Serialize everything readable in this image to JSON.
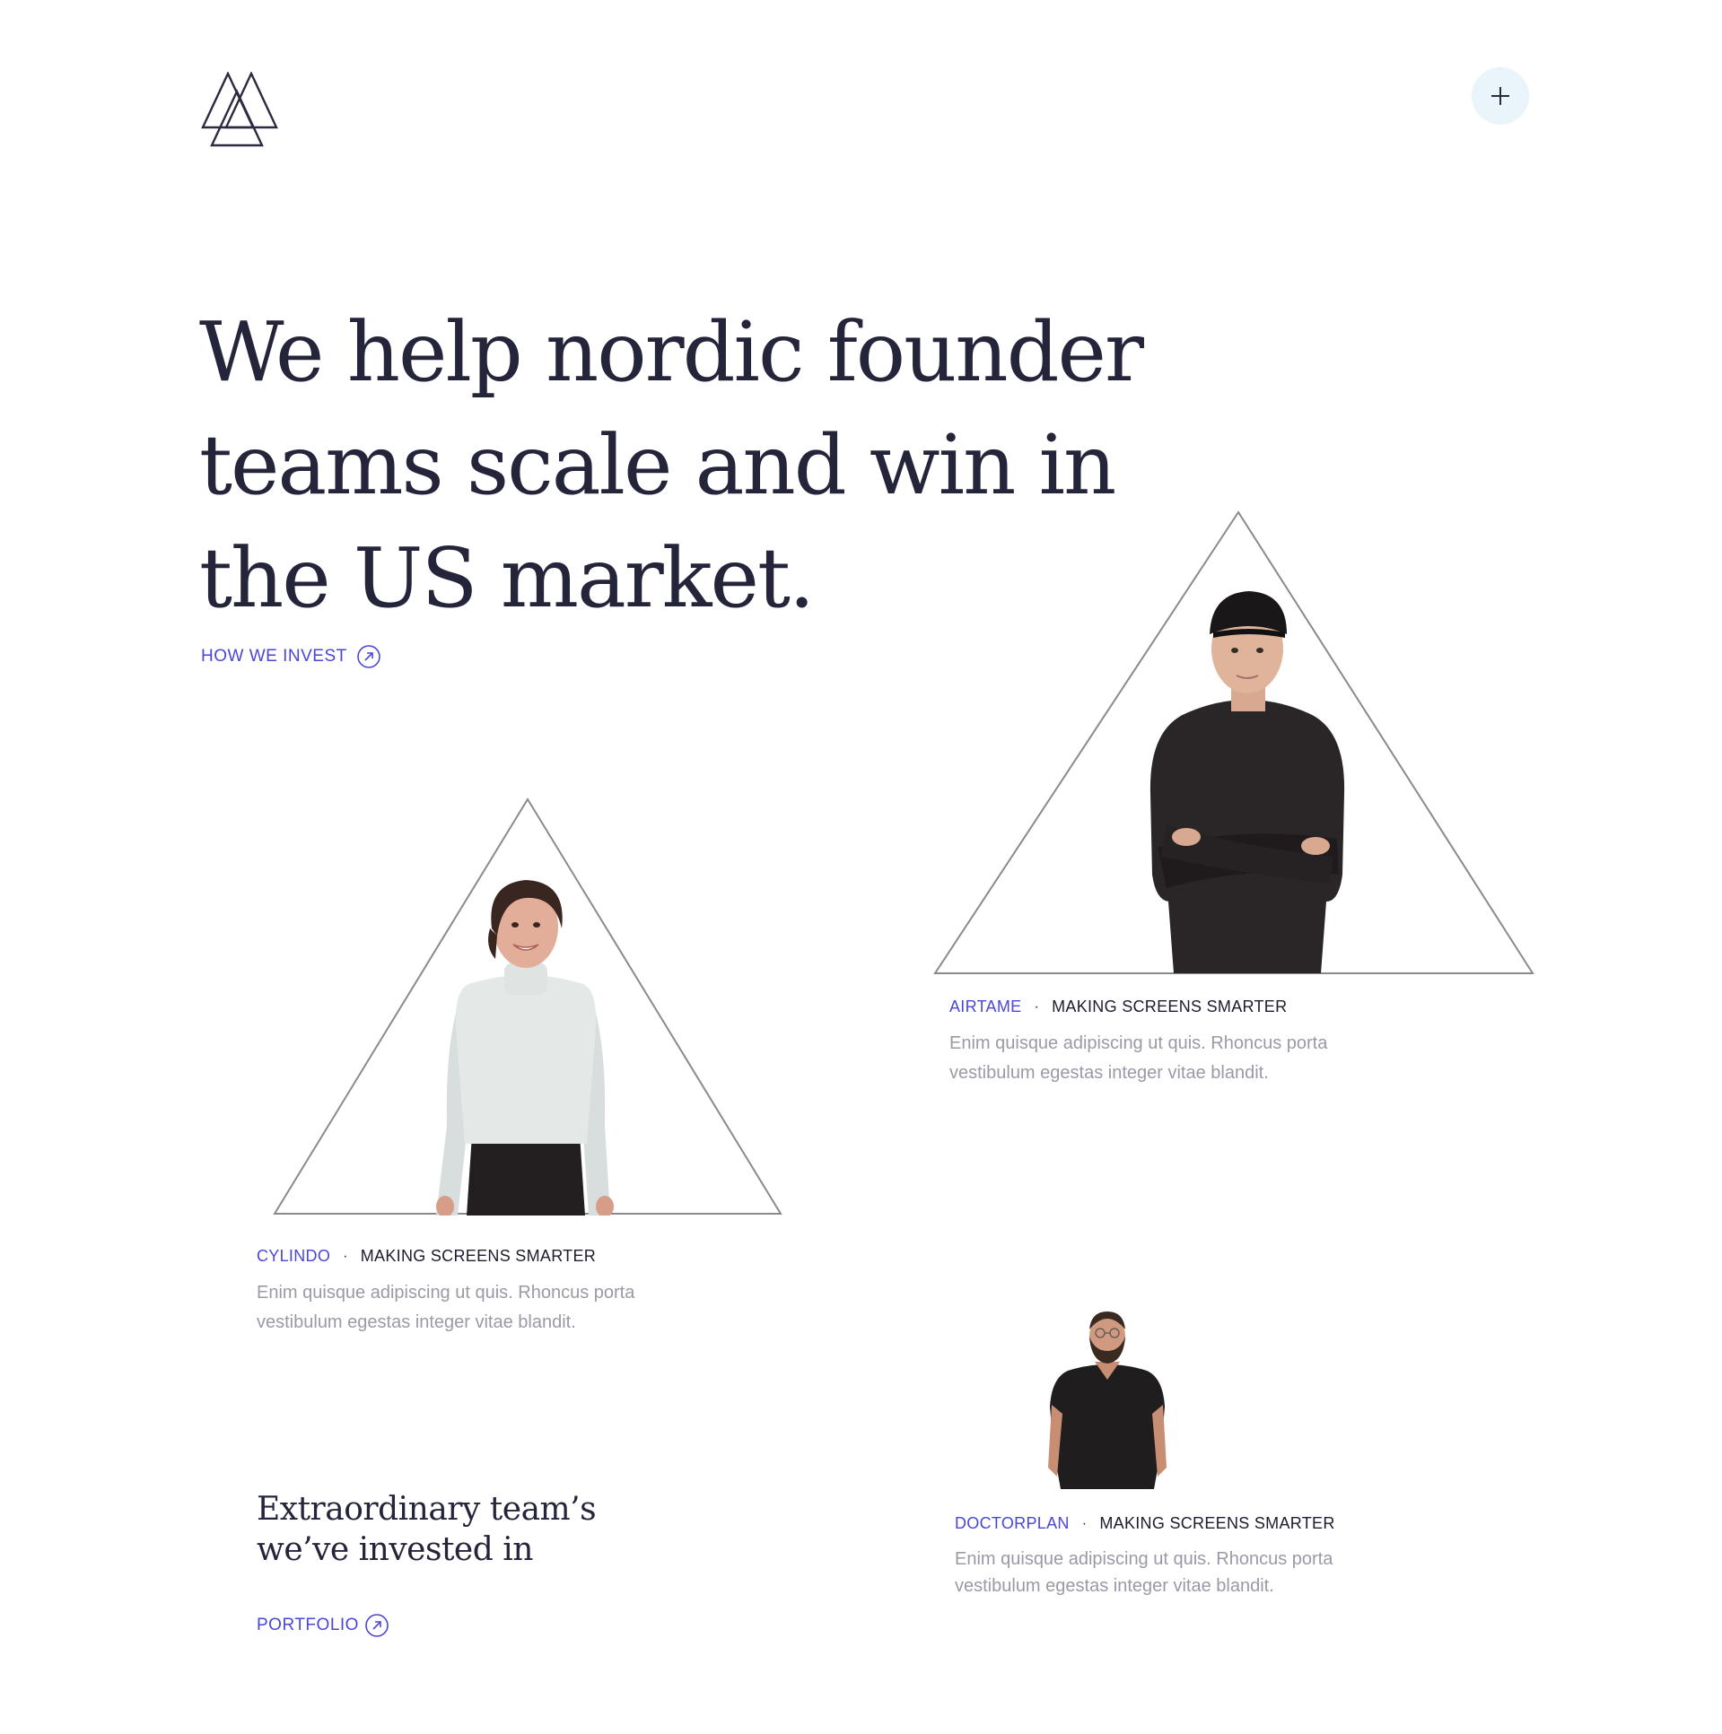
{
  "header": {
    "logo_icon": "triangle-logo-icon",
    "menu_icon": "plus-icon"
  },
  "hero": {
    "title": "We help nordic founder teams scale and win in the US market.",
    "cta_label": "HOW WE INVEST",
    "cta_icon": "arrow-up-right-circle-icon"
  },
  "cards": [
    {
      "company": "AIRTAME",
      "tagline": "MAKING SCREENS SMARTER",
      "description": "Enim quisque adipiscing ut quis. Rhoncus porta vestibulum egestas integer vitae blandit."
    },
    {
      "company": "CYLINDO",
      "tagline": "MAKING SCREENS SMARTER",
      "description": "Enim quisque adipiscing ut quis. Rhoncus porta vestibulum egestas integer vitae blandit."
    },
    {
      "company": "DOCTORPLAN",
      "tagline": "MAKING SCREENS SMARTER",
      "description": "Enim quisque adipiscing ut quis. Rhoncus porta vestibulum egestas integer vitae blandit."
    }
  ],
  "portfolio": {
    "title": "Extraordinary team’s we’ve invested in",
    "cta_label": "PORTFOLIO",
    "cta_icon": "arrow-up-right-circle-icon"
  },
  "colors": {
    "accent": "#4a46d8",
    "text": "#24243a",
    "muted": "#9a9aa6",
    "menu_bg": "#eaf4fb"
  }
}
